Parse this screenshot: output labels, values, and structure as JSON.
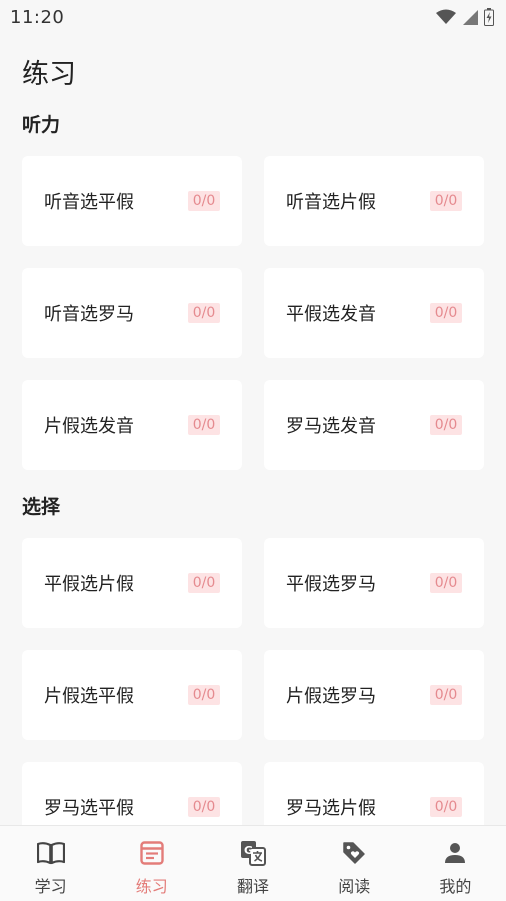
{
  "status": {
    "time": "11:20"
  },
  "header": {
    "title": "练习"
  },
  "sections": [
    {
      "title": "听力",
      "items": [
        {
          "label": "听音选平假",
          "badge": "0/0"
        },
        {
          "label": "听音选片假",
          "badge": "0/0"
        },
        {
          "label": "听音选罗马",
          "badge": "0/0"
        },
        {
          "label": "平假选发音",
          "badge": "0/0"
        },
        {
          "label": "片假选发音",
          "badge": "0/0"
        },
        {
          "label": "罗马选发音",
          "badge": "0/0"
        }
      ]
    },
    {
      "title": "选择",
      "items": [
        {
          "label": "平假选片假",
          "badge": "0/0"
        },
        {
          "label": "平假选罗马",
          "badge": "0/0"
        },
        {
          "label": "片假选平假",
          "badge": "0/0"
        },
        {
          "label": "片假选罗马",
          "badge": "0/0"
        },
        {
          "label": "罗马选平假",
          "badge": "0/0"
        },
        {
          "label": "罗马选片假",
          "badge": "0/0"
        }
      ]
    }
  ],
  "nav": [
    {
      "label": "学习",
      "icon": "book-icon",
      "active": false
    },
    {
      "label": "练习",
      "icon": "clipboard-icon",
      "active": true
    },
    {
      "label": "翻译",
      "icon": "translate-icon",
      "active": false
    },
    {
      "label": "阅读",
      "icon": "tag-heart-icon",
      "active": false
    },
    {
      "label": "我的",
      "icon": "user-icon",
      "active": false
    }
  ],
  "colors": {
    "accent": "#e37c79",
    "badge_bg": "#fde3e4",
    "badge_text": "#e58a8f",
    "background": "#f7f7f7"
  }
}
